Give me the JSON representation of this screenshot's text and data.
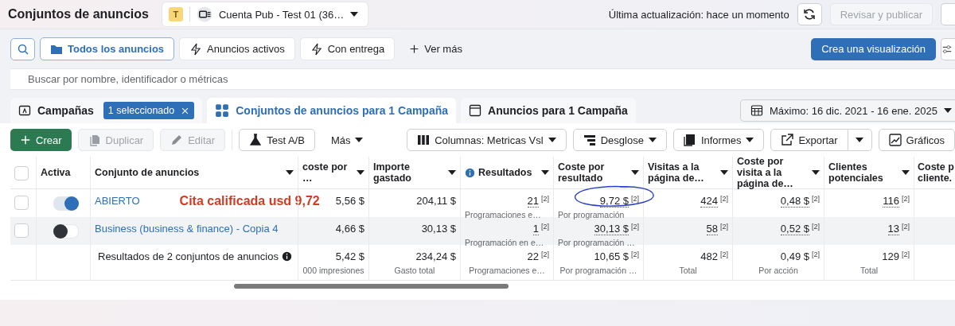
{
  "header": {
    "title": "Conjuntos de anuncios",
    "account": {
      "badge": "T",
      "name": "Cuenta Pub - Test 01 (36…"
    },
    "last_update": "Última actualización: hace un momento",
    "publish": {
      "label": "Revisar y publicar",
      "disabled": true
    }
  },
  "filters": {
    "items": [
      {
        "label": "Todos los anuncios",
        "selected": true
      },
      {
        "label": "Anuncios activos",
        "selected": false
      },
      {
        "label": "Con entrega",
        "selected": false
      }
    ],
    "more": "Ver más",
    "create_view": "Crea una visualización"
  },
  "search": {
    "placeholder": "Buscar por nombre, identificador o métricas"
  },
  "tabs": [
    {
      "label": "Campañas",
      "selected": false,
      "chip": "1 seleccionado"
    },
    {
      "label": "Conjuntos de anuncios para 1 Campaña",
      "selected": true
    },
    {
      "label": "Anuncios para 1 Campaña",
      "selected": false
    }
  ],
  "date_range": "Máximo: 16 dic. 2021 - 16 ene. 2025",
  "toolbar": {
    "left": [
      {
        "label": "Crear",
        "kind": "primary",
        "disabled": false
      },
      {
        "label": "Duplicar",
        "kind": "duplicate",
        "disabled": true
      },
      {
        "label": "Editar",
        "kind": "edit",
        "disabled": true
      },
      {
        "label": "Test A/B",
        "kind": "flask",
        "disabled": false
      },
      {
        "label": "Más",
        "kind": "menu",
        "disabled": false
      }
    ],
    "right": [
      {
        "label": "Columnas: Metricas Vsl",
        "kind": "columns"
      },
      {
        "label": "Desglose",
        "kind": "breakdown"
      },
      {
        "label": "Informes",
        "kind": "reports"
      },
      {
        "label": "Exportar",
        "kind": "export"
      },
      {
        "label": "Gráficos",
        "kind": "charts"
      }
    ]
  },
  "table": {
    "select_all": {
      "checked": false
    },
    "fixed_columns": [
      "Activa",
      "Conjunto de anuncios"
    ],
    "columns": [
      "coste por …",
      "Importe gastado",
      "Resultados",
      "Coste por resultado",
      "Visitas a la página de…",
      "Coste por visita a la página de…",
      "Clientes potenciales",
      "Coste p cliente."
    ],
    "rows": [
      {
        "checked": false,
        "active": true,
        "highlighted": false,
        "name": "ABIERTO",
        "annotation": "Cita calificada usd 9,72",
        "cells": [
          {
            "value": "5,56 $"
          },
          {
            "value": "204,11 $"
          },
          {
            "value": "21",
            "note": "[2]",
            "sub": "Programaciones e…"
          },
          {
            "value": "9,72 $",
            "note": "[2]",
            "sub": "Por programación"
          },
          {
            "value": "424",
            "note": "[2]"
          },
          {
            "value": "0,48 $",
            "note": "[2]"
          },
          {
            "value": "116",
            "note": "[2]"
          }
        ]
      },
      {
        "checked": false,
        "active": false,
        "highlighted": true,
        "name": "Business (business & finance) - Copia 4",
        "cells": [
          {
            "value": "4,66 $"
          },
          {
            "value": "30,13 $"
          },
          {
            "value": "1",
            "note": "[2]",
            "sub": "Programación en e…"
          },
          {
            "value": "30,13 $",
            "note": "[2]",
            "sub": "Por programación …"
          },
          {
            "value": "58",
            "note": "[2]"
          },
          {
            "value": "0,52 $",
            "note": "[2]"
          },
          {
            "value": "13",
            "note": "[2]"
          }
        ]
      }
    ],
    "summary": {
      "label": "Resultados de 2 conjuntos de anuncios",
      "cells": [
        {
          "value": "5,42 $",
          "sub": "000 impresiones"
        },
        {
          "value": "234,24 $",
          "sub": "Gasto total"
        },
        {
          "value": "22",
          "note": "[2]",
          "sub": "Programaciones e…"
        },
        {
          "value": "10,65 $",
          "note": "[2]",
          "sub": "Por programación …"
        },
        {
          "value": "482",
          "note": "[2]",
          "sub": "Total"
        },
        {
          "value": "0,49 $",
          "note": "[2]",
          "sub": "Por acción"
        },
        {
          "value": "129",
          "note": "[2]",
          "sub": "Total"
        }
      ]
    }
  }
}
